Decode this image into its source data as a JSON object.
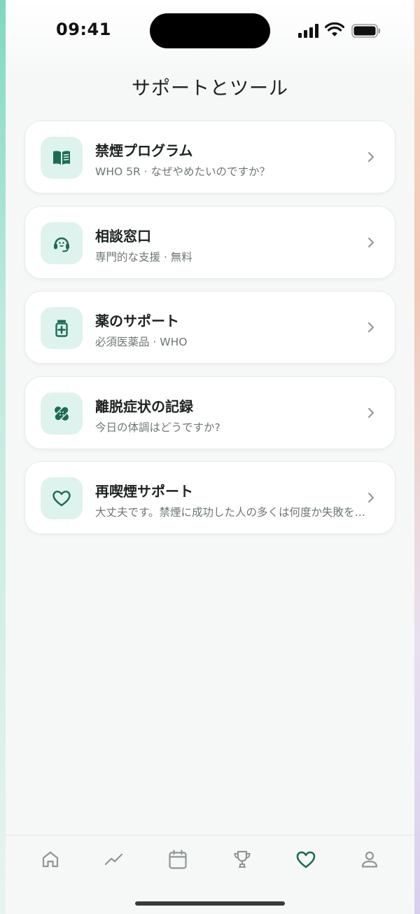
{
  "status_bar": {
    "time": "09:41"
  },
  "page": {
    "title": "サポートとツール"
  },
  "cards": [
    {
      "title": "禁煙プログラム",
      "subtitle": "WHO 5R · なぜやめたいのですか？",
      "icon": "book-icon"
    },
    {
      "title": "相談窓口",
      "subtitle": "専門的な支援 · 無料",
      "icon": "headset-icon"
    },
    {
      "title": "薬のサポート",
      "subtitle": "必須医薬品 · WHO",
      "icon": "medicine-icon"
    },
    {
      "title": "離脱症状の記録",
      "subtitle": "今日の体調はどうですか?",
      "icon": "bandage-icon"
    },
    {
      "title": "再喫煙サポート",
      "subtitle": "大丈夫です。禁煙に成功した人の多くは何度か失敗を経験しています。",
      "icon": "heart-icon"
    }
  ],
  "tab_bar": {
    "items": [
      {
        "icon": "home-icon",
        "active": false
      },
      {
        "icon": "trend-icon",
        "active": false
      },
      {
        "icon": "calendar-icon",
        "active": false
      },
      {
        "icon": "trophy-icon",
        "active": false
      },
      {
        "icon": "heart-icon",
        "active": true
      },
      {
        "icon": "profile-icon",
        "active": false
      }
    ]
  },
  "colors": {
    "accent": "#1c6b55",
    "icon_bg": "#dff3ee",
    "inactive_tab": "#8e9692",
    "card_bg": "#ffffff",
    "text_primary": "#1d2320",
    "text_secondary": "#6e7773"
  }
}
